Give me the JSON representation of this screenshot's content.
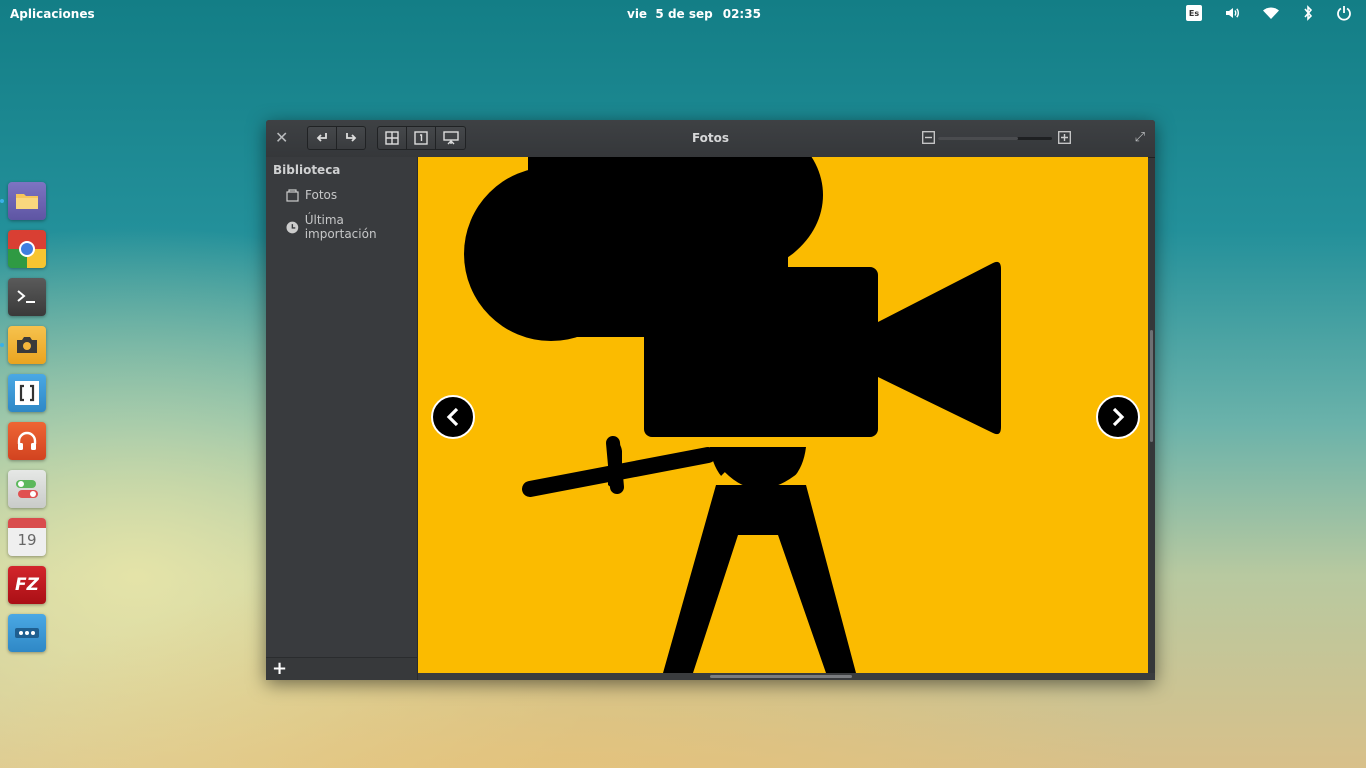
{
  "panel": {
    "applications_label": "Aplicaciones",
    "date": "vie  5 de sep",
    "time": "02:35",
    "keyboard_layout": "Es"
  },
  "dock": {
    "apps": [
      {
        "name": "files",
        "color": "#6b62b0"
      },
      {
        "name": "chrome",
        "color": "#2f9a43"
      },
      {
        "name": "terminal",
        "color": "#4a4a4a"
      },
      {
        "name": "camera",
        "color": "#f3b53b"
      },
      {
        "name": "code-editor",
        "color": "#3e9bd8"
      },
      {
        "name": "music",
        "color": "#e2502a"
      },
      {
        "name": "settings",
        "color": "#d8dad8"
      },
      {
        "name": "calendar",
        "color": "#efefef",
        "day": "19"
      },
      {
        "name": "filezilla",
        "color": "#c4161c",
        "label": "FZ"
      },
      {
        "name": "more-apps",
        "color": "#3c98d8"
      }
    ]
  },
  "window": {
    "title": "Fotos",
    "sidebar": {
      "heading": "Biblioteca",
      "items": [
        {
          "label": "Fotos",
          "icon": "photos-icon"
        },
        {
          "label": "Última importación",
          "icon": "clock-icon"
        }
      ]
    },
    "viewer": {
      "background": "#fbbb00"
    },
    "zoom_level": 0.7
  }
}
